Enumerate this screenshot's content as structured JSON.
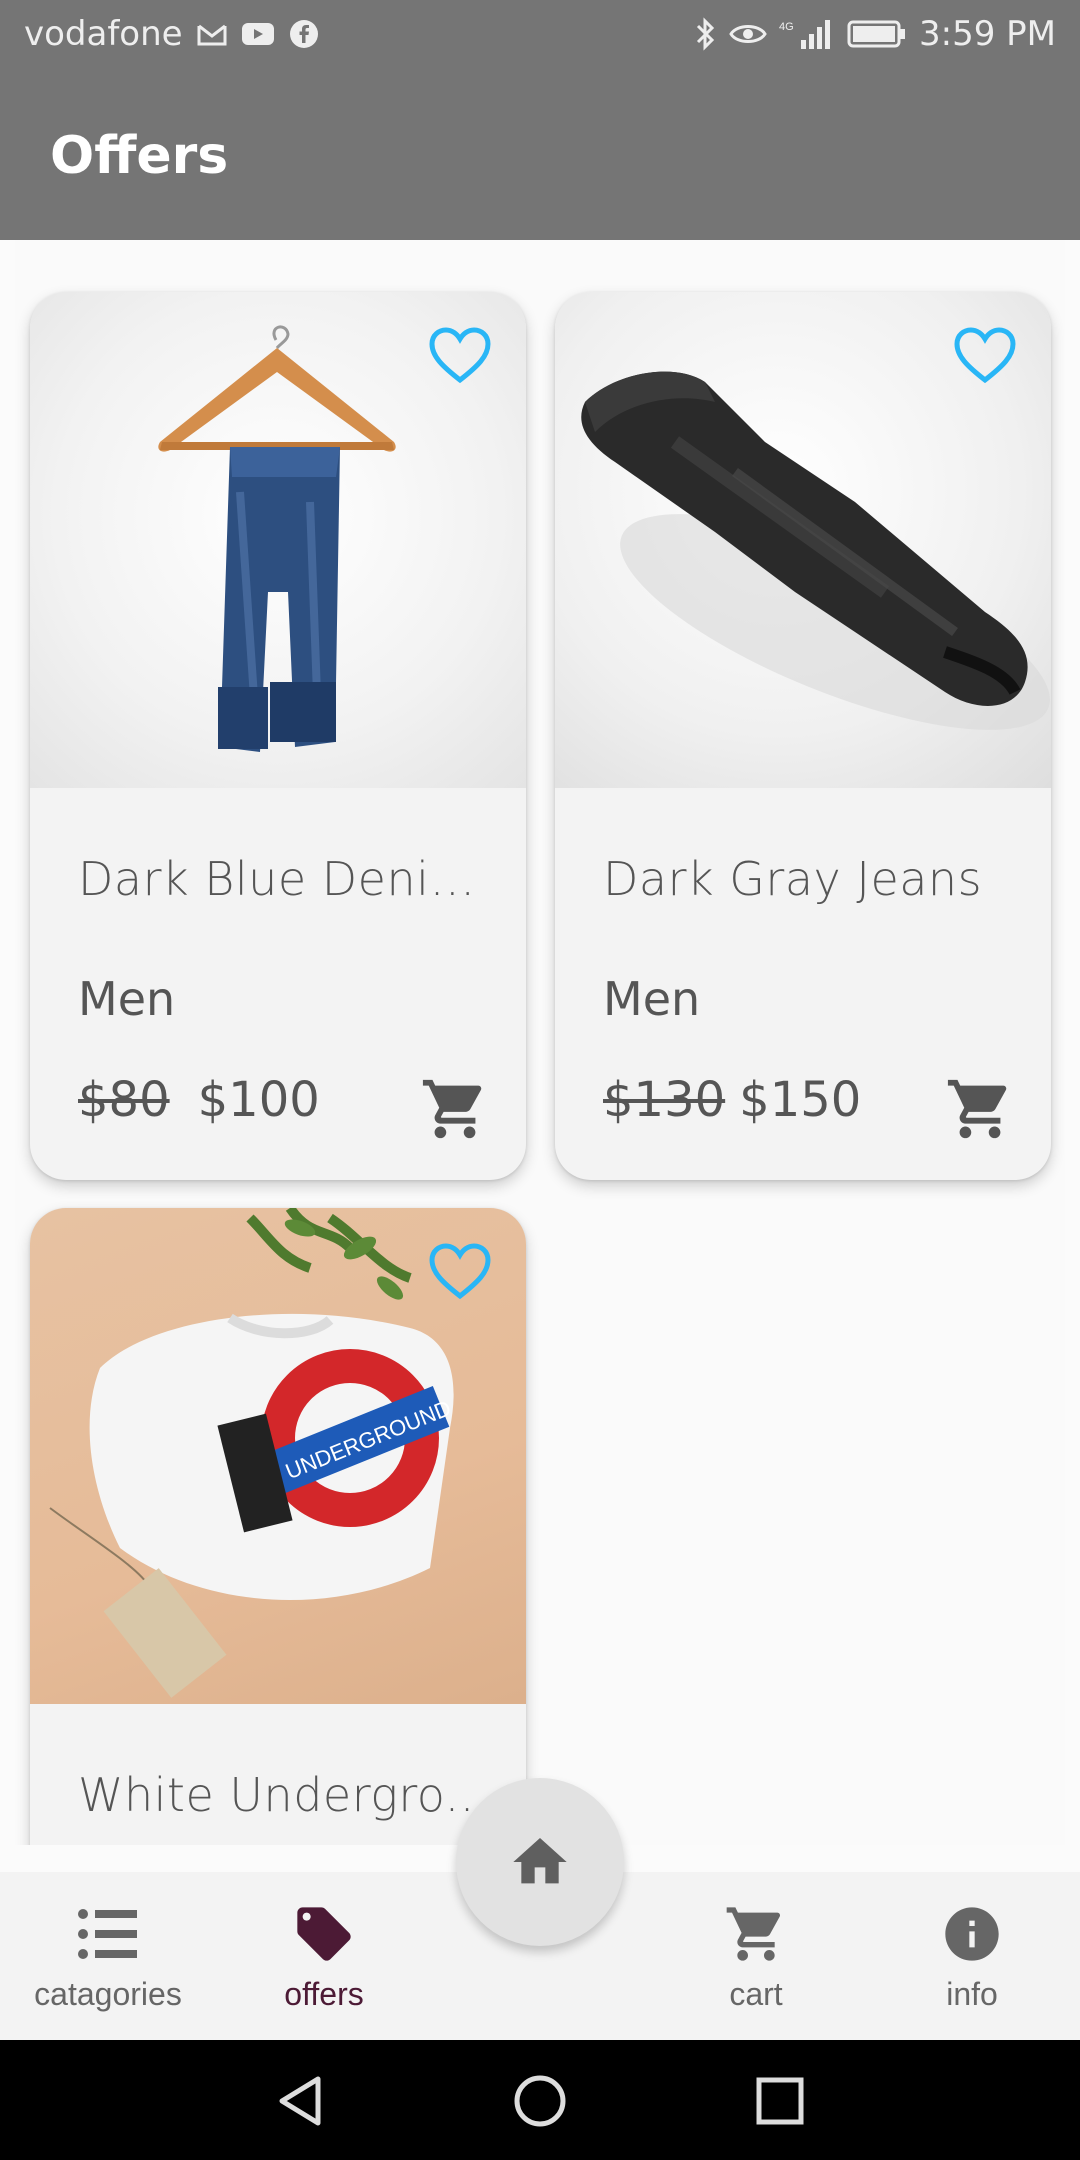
{
  "status_bar": {
    "carrier": "vodafone",
    "time": "3:59 PM",
    "network": "4G"
  },
  "app_bar": {
    "title": "Offers"
  },
  "products": [
    {
      "name": "Dark Blue Denim...",
      "category": "Men",
      "old_price": "$80",
      "price": "$100",
      "image": "jeans-on-hanger"
    },
    {
      "name": "Dark Gray Jeans",
      "category": "Men",
      "old_price": "$130",
      "price": "$150",
      "image": "gray-jeans-lying"
    },
    {
      "name": "White Undergro...",
      "category": "",
      "old_price": "",
      "price": "",
      "image": "folded-tshirt-underground"
    }
  ],
  "bottom_nav": {
    "items": [
      {
        "label": "catagories",
        "icon": "list-icon"
      },
      {
        "label": "offers",
        "icon": "tag-icon"
      },
      {
        "label": "cart",
        "icon": "cart-icon"
      },
      {
        "label": "info",
        "icon": "info-icon"
      }
    ],
    "home_icon": "home-icon"
  },
  "colors": {
    "appbar": "#757575",
    "heart": "#29b6f6",
    "active_nav": "#4c1a35",
    "text": "#555555"
  }
}
